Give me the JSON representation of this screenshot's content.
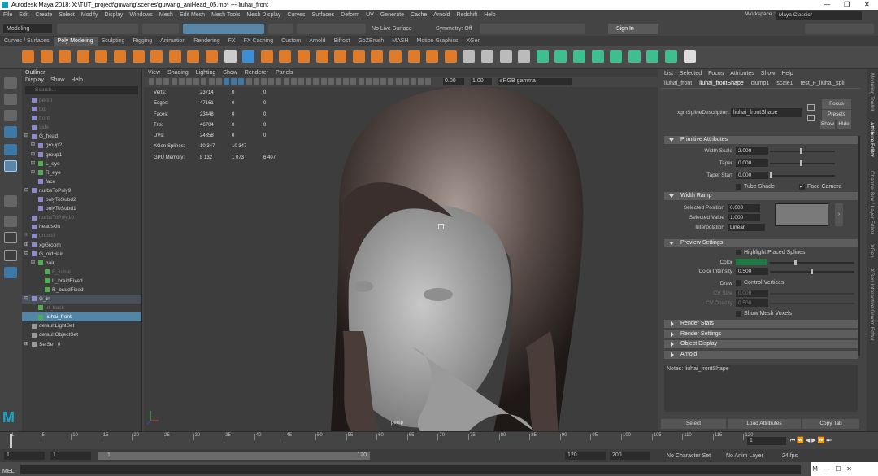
{
  "window": {
    "title": "Autodesk Maya 2018: X:\\TUT_project\\guwang\\scenes\\guwang_aniHead_05.mb* --- liuhai_front"
  },
  "menubar": [
    "File",
    "Edit",
    "Create",
    "Select",
    "Modify",
    "Display",
    "Windows",
    "Mesh",
    "Edit Mesh",
    "Mesh Tools",
    "Mesh Display",
    "Curves",
    "Surfaces",
    "Deform",
    "UV",
    "Generate",
    "Cache",
    "Arnold",
    "Redshift",
    "Help"
  ],
  "workspace": {
    "label": "Workspace :",
    "value": "Maya Classic*"
  },
  "status": {
    "mode": "Modeling",
    "live": "No Live Surface",
    "symmetry": "Symmetry: Off",
    "signin": "Sign In"
  },
  "shelf_tabs": [
    "Curves / Surfaces",
    "Poly Modeling",
    "Sculpting",
    "Rigging",
    "Animation",
    "Rendering",
    "FX",
    "FX Caching",
    "Custom",
    "Arnold",
    "Bifrost",
    "GoZBrush",
    "MASH",
    "Motion Graphics",
    "XGen"
  ],
  "outliner": {
    "title": "Outliner",
    "menu": [
      "Display",
      "Show",
      "Help"
    ],
    "search": "Search...",
    "rows": [
      {
        "label": "persp",
        "indent": 0,
        "dim": true,
        "exp": ""
      },
      {
        "label": "top",
        "indent": 0,
        "dim": true,
        "exp": ""
      },
      {
        "label": "front",
        "indent": 0,
        "dim": true,
        "exp": ""
      },
      {
        "label": "side",
        "indent": 0,
        "dim": true,
        "exp": ""
      },
      {
        "label": "G_head",
        "indent": 0,
        "dim": false,
        "exp": "-"
      },
      {
        "label": "group2",
        "indent": 1,
        "dim": false,
        "exp": "+"
      },
      {
        "label": "group1",
        "indent": 1,
        "dim": false,
        "exp": "+"
      },
      {
        "label": "L_eye",
        "indent": 1,
        "dim": false,
        "exp": "+"
      },
      {
        "label": "R_eye",
        "indent": 1,
        "dim": false,
        "exp": "+"
      },
      {
        "label": "face",
        "indent": 1,
        "dim": false,
        "exp": ""
      },
      {
        "label": "nurbsToPoly9",
        "indent": 0,
        "dim": false,
        "exp": "-"
      },
      {
        "label": "polyToSubd2",
        "indent": 1,
        "dim": false,
        "exp": ""
      },
      {
        "label": "polyToSubd1",
        "indent": 1,
        "dim": false,
        "exp": ""
      },
      {
        "label": "nurbsToPoly10",
        "indent": 0,
        "dim": true,
        "exp": ""
      },
      {
        "label": "headskin",
        "indent": 0,
        "dim": false,
        "exp": ""
      },
      {
        "label": "group3",
        "indent": 0,
        "dim": true,
        "exp": "+"
      },
      {
        "label": "xgGroom",
        "indent": 0,
        "dim": false,
        "exp": "+"
      },
      {
        "label": "G_oldHair",
        "indent": 0,
        "dim": false,
        "exp": "-"
      },
      {
        "label": "hair",
        "indent": 1,
        "dim": false,
        "exp": "-"
      },
      {
        "label": "F_liuhai",
        "indent": 2,
        "dim": true,
        "exp": ""
      },
      {
        "label": "L_braidFixed",
        "indent": 2,
        "dim": false,
        "exp": ""
      },
      {
        "label": "R_braidFixed",
        "indent": 2,
        "dim": false,
        "exp": ""
      },
      {
        "label": "G_irt",
        "indent": 0,
        "dim": false,
        "exp": "-",
        "band": true
      },
      {
        "label": "irt_back",
        "indent": 1,
        "dim": true,
        "exp": ""
      },
      {
        "label": "liuhai_front",
        "indent": 1,
        "dim": false,
        "exp": "",
        "sel": true
      },
      {
        "label": "defaultLightSet",
        "indent": 0,
        "dim": false,
        "exp": ""
      },
      {
        "label": "defaultObjectSet",
        "indent": 0,
        "dim": false,
        "exp": ""
      },
      {
        "label": "SelSet_0",
        "indent": 0,
        "dim": false,
        "exp": "+"
      }
    ]
  },
  "viewport": {
    "menu": [
      "View",
      "Shading",
      "Lighting",
      "Show",
      "Renderer",
      "Panels"
    ],
    "exposure": "0.00",
    "gamma": "1.00",
    "colorspace": "sRGB gamma",
    "camera": "persp",
    "hud": [
      [
        "Verts:",
        "23714",
        "0",
        "0"
      ],
      [
        "Edges:",
        "47161",
        "0",
        "0"
      ],
      [
        "Faces:",
        "23448",
        "0",
        "0"
      ],
      [
        "Tris:",
        "46704",
        "0",
        "0"
      ],
      [
        "UVs:",
        "24358",
        "0",
        "0"
      ],
      [
        "XGen Splines:",
        "10 347",
        "10 347",
        ""
      ],
      [
        "GPU Memory:",
        "8 132",
        "1 073",
        "6 407"
      ]
    ]
  },
  "attr": {
    "menu": [
      "List",
      "Selected",
      "Focus",
      "Attributes",
      "Show",
      "Help"
    ],
    "tabs": [
      "liuhai_front",
      "liuhai_frontShape",
      "clump1",
      "scale1",
      "test_F_liuhai_spli"
    ],
    "desc_label": "xgmSplineDescription:",
    "desc_value": "liuhai_frontShape",
    "focus": "Focus",
    "presets": "Presets",
    "show": "Show",
    "hide": "Hide",
    "sec_primitive": "Primitive Attributes",
    "width_scale_l": "Width Scale",
    "width_scale": "2.000",
    "taper_l": "Taper",
    "taper": "0.000",
    "taper_start_l": "Taper Start",
    "taper_start": "0.000",
    "tube_shade": "Tube Shade",
    "face_camera": "Face Camera",
    "sec_ramp": "Width Ramp",
    "sel_pos_l": "Selected Position",
    "sel_pos": "0.000",
    "sel_val_l": "Selected Value",
    "sel_val": "1.000",
    "interp_l": "Interpolation",
    "interp": "Linear",
    "sec_preview": "Preview Settings",
    "highlight": "Highlight Placed Splines",
    "color_l": "Color",
    "color": "#1d7a45",
    "intensity_l": "Color Intensity",
    "intensity": "0.500",
    "draw_l": "Draw",
    "control_verts": "Control Vertices",
    "cv_size_l": "CV Size",
    "cv_size": "0.000",
    "cv_opacity_l": "CV Opacity",
    "cv_opacity": "0.500",
    "show_voxels": "Show Mesh Voxels",
    "closed": [
      "Render Stats",
      "Render Settings",
      "Object Display",
      "Arnold"
    ],
    "notes": "Notes:  liuhai_frontShape",
    "select": "Select",
    "load": "Load Attributes",
    "copy": "Copy Tab"
  },
  "right_tabs": [
    "Modeling Toolkit",
    "Attribute Editor",
    "Channel Box / Layer Editor",
    "XGen",
    "XGen Interactive Groom Editor"
  ],
  "time": {
    "ticks": [
      "1",
      "5",
      "10",
      "15",
      "20",
      "25",
      "30",
      "35",
      "40",
      "45",
      "50",
      "55",
      "60",
      "65",
      "70",
      "75",
      "80",
      "85",
      "90",
      "95",
      "100",
      "105",
      "110",
      "115",
      "120"
    ],
    "current": "1",
    "start": "1",
    "start2": "1",
    "range_label": "1",
    "range_end": "120",
    "end": "120",
    "end2": "200",
    "char": "No Character Set",
    "anim": "No Anim Layer",
    "fps": "24 fps",
    "mel": "MEL"
  }
}
